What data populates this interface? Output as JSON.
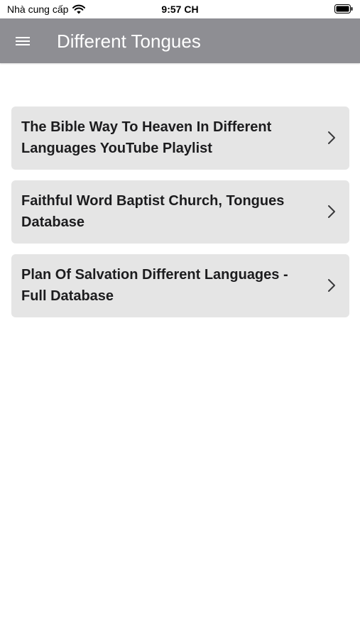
{
  "status_bar": {
    "carrier": "Nhà cung cấp",
    "time": "9:57 CH",
    "wifi_icon": "wifi-icon",
    "battery_icon": "battery-icon"
  },
  "app_bar": {
    "title": "Different Tongues",
    "menu_icon": "hamburger-menu-icon",
    "background_color": "#8e8e93",
    "text_color": "#ffffff"
  },
  "list": {
    "items": [
      {
        "label": "The Bible Way To Heaven In Different Languages YouTube Playlist",
        "icon": "chevron-right-icon"
      },
      {
        "label": "Faithful Word Baptist Church, Tongues Database",
        "icon": "chevron-right-icon"
      },
      {
        "label": "Plan Of Salvation Different Languages - Full Database",
        "icon": "chevron-right-icon"
      }
    ],
    "card_color": "#e5e5e5"
  }
}
